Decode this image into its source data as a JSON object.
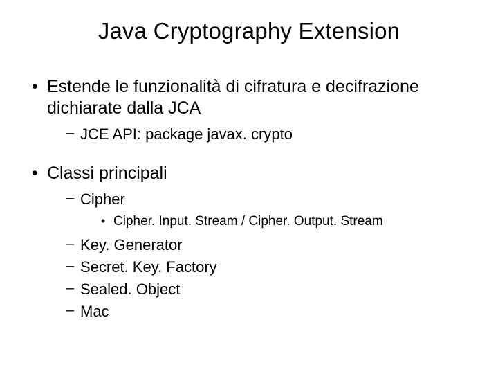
{
  "title": "Java Cryptography Extension",
  "bullets": [
    {
      "text": "Estende le funzionalità di cifratura e decifrazione dichiarate dalla JCA",
      "children": [
        {
          "text": "JCE API: package javax. crypto"
        }
      ]
    },
    {
      "text": "Classi principali",
      "children": [
        {
          "text": "Cipher",
          "children": [
            {
              "text": "Cipher. Input. Stream / Cipher. Output. Stream"
            }
          ]
        },
        {
          "text": "Key. Generator"
        },
        {
          "text": "Secret. Key. Factory"
        },
        {
          "text": "Sealed. Object"
        },
        {
          "text": "Mac"
        }
      ]
    }
  ]
}
